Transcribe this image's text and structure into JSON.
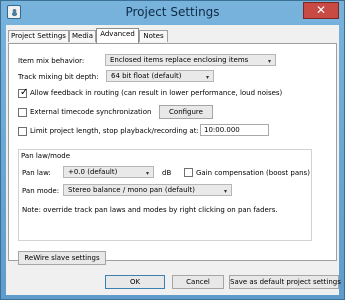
{
  "window": {
    "title": "Project Settings",
    "close_glyph": "✕"
  },
  "tabs": [
    {
      "label": "Project Settings"
    },
    {
      "label": "Media"
    },
    {
      "label": "Advanced"
    },
    {
      "label": "Notes"
    }
  ],
  "advanced": {
    "item_mix_behavior": {
      "label": "Item mix behavior:",
      "value": "Enclosed items replace enclosing items"
    },
    "track_mixing_bit_depth": {
      "label": "Track mixing bit depth:",
      "value": "64 bit float (default)"
    },
    "allow_feedback": {
      "label": "Allow feedback in routing (can result in lower performance, loud noises)",
      "checked": true
    },
    "external_timecode": {
      "label": "External timecode synchronization",
      "checked": false,
      "configure_label": "Configure"
    },
    "limit_project_length": {
      "label": "Limit project length, stop playback/recording at:",
      "checked": false,
      "value": "10:00.000"
    },
    "pan_group": {
      "title": "Pan law/mode",
      "pan_law_label": "Pan law:",
      "pan_law_value": "+0.0 (default)",
      "db_label": "dB",
      "gain_comp_label": "Gain compensation (boost pans)",
      "gain_comp_checked": false,
      "pan_mode_label": "Pan mode:",
      "pan_mode_value": "Stereo balance / mono pan (default)",
      "note": "Note: override track pan laws and modes by right clicking on pan faders."
    },
    "rewire_button": "ReWire slave settings"
  },
  "footer": {
    "ok": "OK",
    "cancel": "Cancel",
    "save_default": "Save as default project settings"
  },
  "icons": {
    "dropdown": "▾"
  },
  "colors": {
    "title_bar": "#78b3dc",
    "close_button": "#c94a43",
    "panel_background": "#ffffff"
  }
}
